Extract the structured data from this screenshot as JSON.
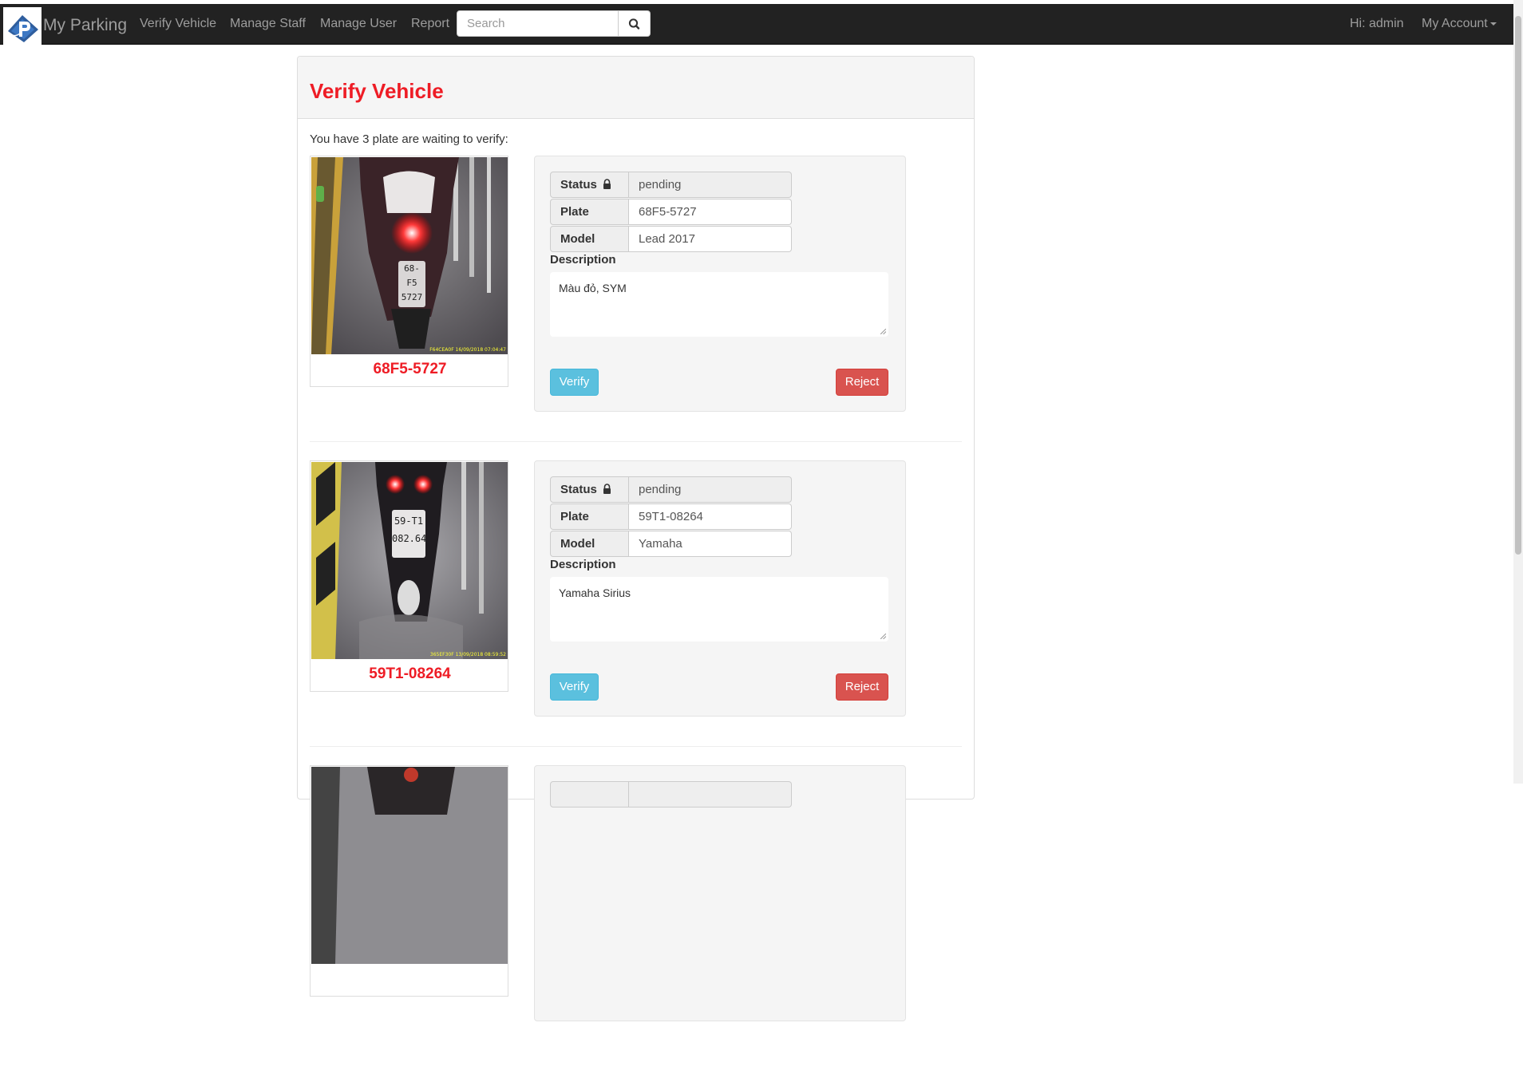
{
  "app": {
    "brand": "My Parking"
  },
  "nav": {
    "links": [
      "Verify Vehicle",
      "Manage Staff",
      "Manage User",
      "Report"
    ],
    "search_placeholder": "Search",
    "greeting": "Hi: admin",
    "account": "My Account"
  },
  "page": {
    "title": "Verify Vehicle",
    "intro": "You have 3 plate are waiting to verify:"
  },
  "labels": {
    "status": "Status",
    "plate": "Plate",
    "model": "Model",
    "description": "Description",
    "verify": "Verify",
    "reject": "Reject"
  },
  "vehicles": [
    {
      "caption": "68F5-5727",
      "status": "pending",
      "plate": "68F5-5727",
      "model": "Lead 2017",
      "description": "Màu đỏ, SYM",
      "plate_on_image": [
        "68-F5",
        "5727"
      ],
      "image_stamp": "F64CEA0F 16/09/2018 07:04:47"
    },
    {
      "caption": "59T1-08264",
      "status": "pending",
      "plate": "59T1-08264",
      "model": "Yamaha",
      "description": "Yamaha Sirius",
      "plate_on_image": [
        "59-T1",
        "082.64"
      ],
      "image_stamp": "365EF30F 13/09/2018 08:59:52"
    }
  ],
  "colors": {
    "accent": "#ee1c25",
    "verify": "#5bc0de",
    "reject": "#d9534f",
    "navbar": "#222222"
  }
}
